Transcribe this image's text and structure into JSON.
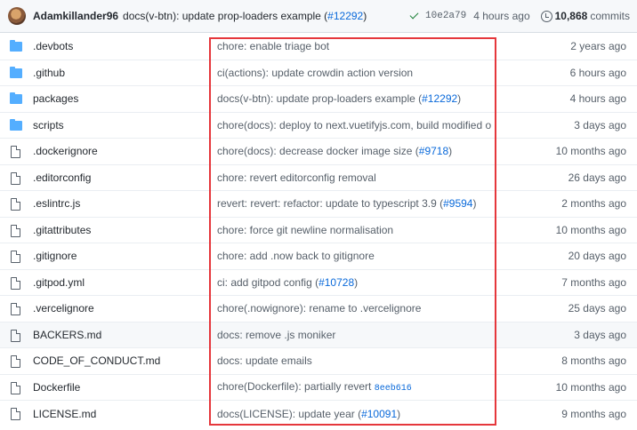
{
  "header": {
    "author": "Adamkillander96",
    "message": "docs(v-btn): update prop-loaders example (",
    "pr": "#12292",
    "message_end": ")",
    "sha": "10e2a79",
    "time": "4 hours ago",
    "commits_count": "10,868",
    "commits_label": "commits"
  },
  "files": [
    {
      "type": "folder",
      "name": ".devbots",
      "msg": "chore: enable triage bot",
      "pr": "",
      "age": "2 years ago"
    },
    {
      "type": "folder",
      "name": ".github",
      "msg": "ci(actions): update crowdin action version",
      "pr": "",
      "age": "6 hours ago"
    },
    {
      "type": "folder",
      "name": "packages",
      "msg": "docs(v-btn): update prop-loaders example (",
      "pr": "#12292",
      "msg_end": ")",
      "age": "4 hours ago"
    },
    {
      "type": "folder",
      "name": "scripts",
      "msg": "chore(docs): deploy to next.vuetifyjs.com, build modified on CI",
      "pr": "",
      "age": "3 days ago"
    },
    {
      "type": "file",
      "name": ".dockerignore",
      "msg": "chore(docs): decrease docker image size (",
      "pr": "#9718",
      "msg_end": ")",
      "age": "10 months ago"
    },
    {
      "type": "file",
      "name": ".editorconfig",
      "msg": "chore: revert editorconfig removal",
      "pr": "",
      "age": "26 days ago"
    },
    {
      "type": "file",
      "name": ".eslintrc.js",
      "msg": "revert: revert: refactor: update to typescript 3.9 (",
      "pr": "#9594",
      "msg_end": ")",
      "age": "2 months ago"
    },
    {
      "type": "file",
      "name": ".gitattributes",
      "msg": "chore: force git newline normalisation",
      "pr": "",
      "age": "10 months ago"
    },
    {
      "type": "file",
      "name": ".gitignore",
      "msg": "chore: add .now back to gitignore",
      "pr": "",
      "age": "20 days ago"
    },
    {
      "type": "file",
      "name": ".gitpod.yml",
      "msg": "ci: add gitpod config (",
      "pr": "#10728",
      "msg_end": ")",
      "age": "7 months ago"
    },
    {
      "type": "file",
      "name": ".vercelignore",
      "msg": "chore(.nowignore): rename to .vercelignore",
      "pr": "",
      "age": "25 days ago"
    },
    {
      "type": "file",
      "name": "BACKERS.md",
      "msg": "docs: remove .js moniker",
      "pr": "",
      "age": "3 days ago",
      "highlight": true
    },
    {
      "type": "file",
      "name": "CODE_OF_CONDUCT.md",
      "msg": "docs: update emails",
      "pr": "",
      "age": "8 months ago"
    },
    {
      "type": "file",
      "name": "Dockerfile",
      "msg": "chore(Dockerfile): partially revert ",
      "sha": "8eeb616",
      "pr": "",
      "age": "10 months ago"
    },
    {
      "type": "file",
      "name": "LICENSE.md",
      "msg": "docs(LICENSE): update year (",
      "pr": "#10091",
      "msg_end": ")",
      "age": "9 months ago"
    }
  ]
}
